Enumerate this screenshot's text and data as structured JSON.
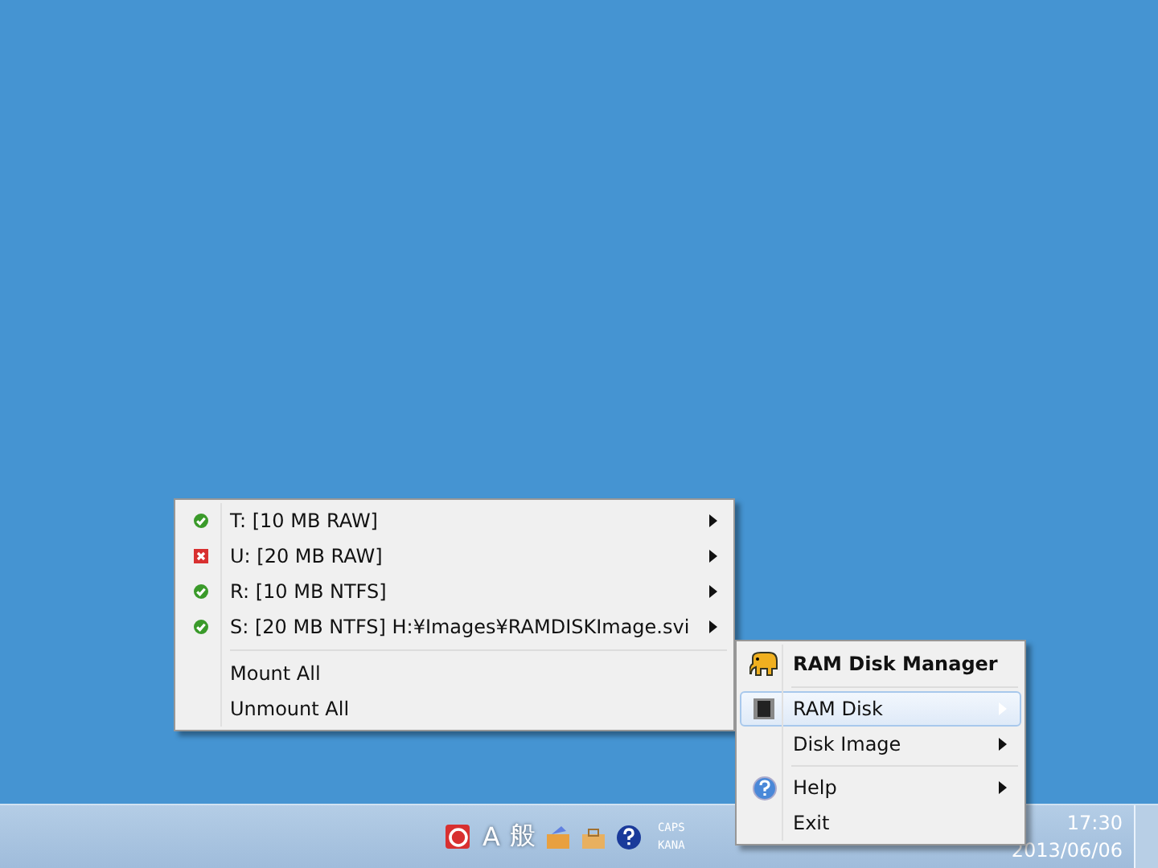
{
  "disk_menu": {
    "disks": [
      {
        "label": "T: [10 MB RAW]",
        "mounted": true,
        "has_submenu": true
      },
      {
        "label": "U: [20 MB RAW]",
        "mounted": false,
        "has_submenu": true
      },
      {
        "label": "R: [10 MB NTFS]",
        "mounted": true,
        "has_submenu": true
      },
      {
        "label": "S: [20 MB NTFS] H:¥Images¥RAMDISKImage.svi",
        "mounted": true,
        "has_submenu": true
      }
    ],
    "actions": [
      {
        "label": "Mount All"
      },
      {
        "label": "Unmount All"
      }
    ]
  },
  "tray_menu": {
    "title": "RAM Disk Manager",
    "groups": [
      [
        {
          "label": "RAM Disk",
          "selected": true,
          "has_submenu": true
        },
        {
          "label": "Disk Image",
          "selected": false,
          "has_submenu": true
        }
      ],
      [
        {
          "label": "Help",
          "selected": false,
          "has_submenu": true
        },
        {
          "label": "Exit",
          "selected": false,
          "has_submenu": false
        }
      ]
    ]
  },
  "taskbar": {
    "ime_mode": "A",
    "ime_type": "般",
    "caps": "CAPS",
    "kana": "KANA",
    "time": "17:30",
    "date": "2013/06/06"
  }
}
